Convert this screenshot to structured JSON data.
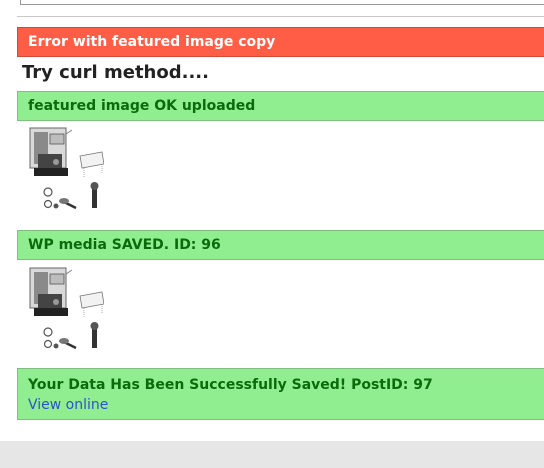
{
  "messages": {
    "error": "Error with featured image copy",
    "curl_title": "Try curl method....",
    "featured_ok": "featured image OK uploaded",
    "media_saved": "WP media SAVED. ID: 96",
    "data_saved": "Your Data Has Been Successfully Saved! PostID: 97",
    "view_online": "View online"
  },
  "colors": {
    "error_bg": "#ff5d45",
    "success_bg": "#90ee90",
    "success_text": "#0b6b0b",
    "link": "#2a55c8"
  },
  "images": [
    {
      "name": "coffee-machine-image"
    },
    {
      "name": "coffee-machine-image"
    }
  ]
}
